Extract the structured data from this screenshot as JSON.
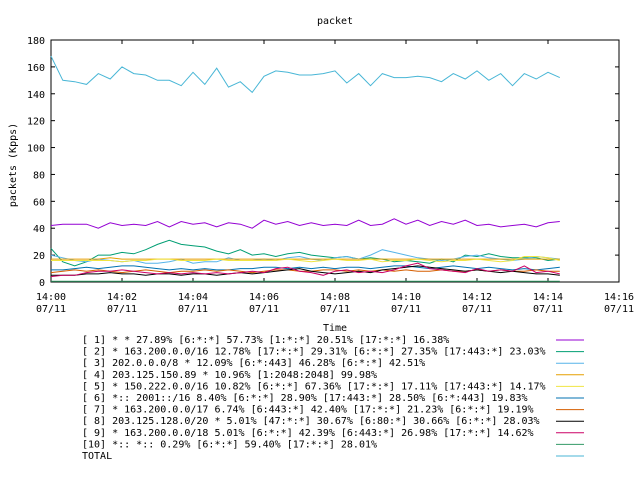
{
  "chart_data": {
    "type": "line",
    "title": "packet",
    "xlabel": "Time",
    "ylabel": "packets (Kpps)",
    "ylim": [
      0,
      180
    ],
    "xlim_minutes": [
      0,
      16
    ],
    "grid": false,
    "legend_placement": "bottom",
    "y_ticks": [
      "0",
      "20",
      "40",
      "60",
      "80",
      "100",
      "120",
      "140",
      "160",
      "180"
    ],
    "x_ticks": [
      {
        "time": "14:00",
        "date": "07/11"
      },
      {
        "time": "14:02",
        "date": "07/11"
      },
      {
        "time": "14:04",
        "date": "07/11"
      },
      {
        "time": "14:06",
        "date": "07/11"
      },
      {
        "time": "14:08",
        "date": "07/11"
      },
      {
        "time": "14:10",
        "date": "07/11"
      },
      {
        "time": "14:12",
        "date": "07/11"
      },
      {
        "time": "14:14",
        "date": "07/11"
      },
      {
        "time": "14:16",
        "date": "07/11"
      }
    ],
    "x_minutes": [
      0,
      0.333,
      0.667,
      1,
      1.333,
      1.667,
      2,
      2.333,
      2.667,
      3,
      3.333,
      3.667,
      4,
      4.333,
      4.667,
      5,
      5.333,
      5.667,
      6,
      6.333,
      6.667,
      7,
      7.333,
      7.667,
      8,
      8.333,
      8.667,
      9,
      9.333,
      9.667,
      10,
      10.333,
      10.667,
      11,
      11.333,
      11.667,
      12,
      12.333,
      12.667,
      13,
      13.333,
      13.667,
      14,
      14.333
    ],
    "series": [
      {
        "name": "[ 1] * * 27.89%  [6:*:*] 57.73% [1:*:*] 20.51% [17:*:*] 16.38%",
        "color": "#9400d3",
        "values": [
          42,
          43,
          43,
          43,
          40,
          44,
          42,
          43,
          42,
          45,
          41,
          45,
          43,
          44,
          41,
          44,
          43,
          40,
          46,
          43,
          45,
          42,
          44,
          42,
          43,
          42,
          46,
          42,
          43,
          47,
          43,
          46,
          42,
          45,
          43,
          46,
          42,
          43,
          41,
          42,
          43,
          41,
          44,
          45
        ]
      },
      {
        "name": "[ 2] * 163.200.0.0/16 12.78%  [17:*:*] 29.31% [6:*:*] 27.35% [17:443:*] 23.03%",
        "color": "#009e73",
        "values": [
          25,
          15,
          12,
          15,
          20,
          20,
          22,
          21,
          24,
          28,
          31,
          28,
          27,
          26,
          23,
          21,
          24,
          20,
          21,
          19,
          21,
          22,
          20,
          19,
          18,
          19,
          17,
          18,
          17,
          15,
          16,
          15,
          14,
          17,
          15,
          20,
          19,
          21,
          19,
          18,
          18,
          18,
          16,
          17
        ]
      },
      {
        "name": "[ 3] 202.0.0.0/8 * 12.09%  [6:*:443] 46.28% [6:*:*] 42.51%",
        "color": "#56b4e9",
        "values": [
          20,
          18,
          16,
          15,
          17,
          16,
          15,
          16,
          14,
          14,
          15,
          17,
          14,
          15,
          15,
          18,
          16,
          16,
          17,
          16,
          18,
          19,
          17,
          16,
          18,
          19,
          17,
          20,
          24,
          22,
          20,
          18,
          17,
          16,
          17,
          19,
          20,
          18,
          17,
          16,
          17,
          19,
          18,
          17
        ]
      },
      {
        "name": "[ 4] 203.125.150.89 * 10.96%  [1:2048:2048] 99.98%",
        "color": "#e69f00",
        "values": [
          17,
          17,
          17,
          17,
          17,
          18,
          17,
          17,
          17,
          17,
          17,
          17,
          17,
          17,
          17,
          17,
          17,
          17,
          17,
          17,
          17,
          17,
          17,
          17,
          17,
          17,
          17,
          17,
          17,
          17,
          17,
          17,
          17,
          17,
          17,
          17,
          17,
          17,
          17,
          17,
          17,
          17,
          17,
          17
        ]
      },
      {
        "name": "[ 5] * 150.222.0.0/16 10.82%  [6:*:*] 67.36% [17:*:*] 17.11% [17:443:*] 14.17%",
        "color": "#f0e442",
        "values": [
          16,
          16,
          16,
          16,
          16,
          16,
          15,
          16,
          16,
          17,
          17,
          16,
          16,
          16,
          17,
          16,
          16,
          16,
          16,
          16,
          17,
          16,
          15,
          16,
          17,
          16,
          16,
          17,
          15,
          16,
          16,
          17,
          16,
          15,
          16,
          16,
          17,
          16,
          15,
          16,
          19,
          19,
          18,
          16
        ]
      },
      {
        "name": "[ 6] *:: 2001::/16 8.40%  [6:*:*] 28.90% [17:443:*] 28.50% [6:*:443] 19.83%",
        "color": "#0072b2",
        "values": [
          9,
          9,
          10,
          11,
          10,
          11,
          12,
          12,
          11,
          10,
          9,
          10,
          9,
          10,
          9,
          9,
          10,
          10,
          11,
          11,
          10,
          11,
          10,
          11,
          10,
          11,
          11,
          10,
          11,
          12,
          12,
          11,
          10,
          11,
          12,
          11,
          10,
          11,
          10,
          9,
          10,
          9,
          10,
          11
        ]
      },
      {
        "name": "[ 7] * 163.200.0.0/17 6.74%  [6:443:*] 42.40% [17:*:*] 21.23% [6:*:*] 19.19%",
        "color": "#d55e00",
        "values": [
          7,
          8,
          9,
          8,
          9,
          8,
          7,
          8,
          9,
          8,
          7,
          8,
          8,
          9,
          8,
          9,
          8,
          7,
          8,
          9,
          9,
          8,
          8,
          9,
          9,
          8,
          9,
          8,
          9,
          8,
          9,
          8,
          8,
          9,
          8,
          8,
          9,
          8,
          9,
          8,
          8,
          9,
          8,
          8
        ]
      },
      {
        "name": "[ 8] 203.125.128.0/20 * 5.01%  [47:*:*] 30.67% [6:80:*] 30.66% [6:*:*] 28.03%",
        "color": "#000000",
        "values": [
          5,
          5,
          5,
          6,
          6,
          7,
          6,
          6,
          5,
          6,
          6,
          5,
          6,
          6,
          5,
          6,
          7,
          6,
          7,
          8,
          9,
          10,
          8,
          7,
          6,
          7,
          8,
          7,
          9,
          10,
          11,
          12,
          11,
          10,
          9,
          8,
          9,
          8,
          7,
          8,
          7,
          6,
          6,
          5
        ]
      },
      {
        "name": "[ 9] * 163.200.0.0/18 5.01%  [6:*:*] 42.39% [6:443:*] 26.98% [17:*:*] 14.62%",
        "color": "#cc0066",
        "values": [
          4,
          5,
          5,
          7,
          8,
          8,
          9,
          8,
          7,
          6,
          7,
          6,
          7,
          6,
          7,
          6,
          7,
          8,
          7,
          10,
          11,
          8,
          7,
          5,
          8,
          9,
          7,
          8,
          7,
          9,
          12,
          14,
          10,
          9,
          8,
          7,
          10,
          8,
          9,
          8,
          12,
          7,
          8,
          6
        ]
      },
      {
        "name": "[10] *:: *:: 0.29%  [6:*:*] 59.40% [17:*:*] 28.01%",
        "color": "#339966",
        "values": [
          0.5,
          0.5,
          0.5,
          0.5,
          0.5,
          0.5,
          0.5,
          0.5,
          0.5,
          0.5,
          0.5,
          0.5,
          0.5,
          0.5,
          0.5,
          0.5,
          0.5,
          0.5,
          0.5,
          0.5,
          0.5,
          0.5,
          0.5,
          0.5,
          0.5,
          0.5,
          0.5,
          0.5,
          0.5,
          0.5,
          0.5,
          0.5,
          0.5,
          0.5,
          0.5,
          0.5,
          0.5,
          0.5,
          0.5,
          0.5,
          0.5,
          0.5,
          0.5,
          0.5
        ]
      },
      {
        "name": "TOTAL",
        "color": "#48b6d6",
        "values": [
          168,
          150,
          149,
          147,
          155,
          151,
          160,
          155,
          154,
          150,
          150,
          146,
          156,
          147,
          159,
          145,
          149,
          141,
          153,
          157,
          156,
          154,
          154,
          155,
          157,
          148,
          155,
          146,
          155,
          152,
          152,
          153,
          152,
          149,
          155,
          151,
          157,
          150,
          155,
          146,
          155,
          151,
          156,
          152
        ]
      }
    ]
  }
}
